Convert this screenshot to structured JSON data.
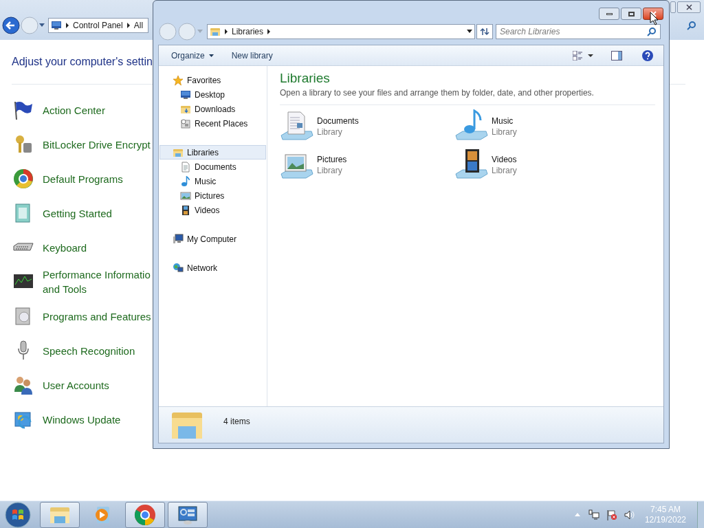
{
  "control_panel": {
    "breadcrumb": [
      "Control Panel",
      "All"
    ],
    "heading": "Adjust your computer's settin",
    "items": [
      {
        "label": "Action Center",
        "kind": "flag"
      },
      {
        "label": "BitLocker Drive Encrypt",
        "kind": "keys"
      },
      {
        "label": "Default Programs",
        "kind": "orb"
      },
      {
        "label": "Getting Started",
        "kind": "doc"
      },
      {
        "label": "Keyboard",
        "kind": "keyboard"
      },
      {
        "label": "Performance Informatio and Tools",
        "kind": "monitor"
      },
      {
        "label": "Programs and Features",
        "kind": "box"
      },
      {
        "label": "Speech Recognition",
        "kind": "mic"
      },
      {
        "label": "User Accounts",
        "kind": "users"
      },
      {
        "label": "Windows Update",
        "kind": "update"
      }
    ]
  },
  "explorer": {
    "breadcrumb": [
      "Libraries"
    ],
    "search": {
      "placeholder": "Search Libraries"
    },
    "toolbar": [
      {
        "label": "Organize",
        "dropdown": true
      },
      {
        "label": "New library",
        "dropdown": false
      }
    ],
    "nav": [
      {
        "label": "Favorites",
        "kind": "star",
        "selected": false,
        "children": [
          {
            "label": "Desktop",
            "kind": "desktop",
            "selected": false
          },
          {
            "label": "Downloads",
            "kind": "folder",
            "selected": false
          },
          {
            "label": "Recent Places",
            "kind": "recent",
            "selected": false
          }
        ]
      },
      {
        "label": "Libraries",
        "kind": "library",
        "selected": true,
        "children": [
          {
            "label": "Documents",
            "kind": "doc",
            "selected": false
          },
          {
            "label": "Music",
            "kind": "note",
            "selected": false
          },
          {
            "label": "Pictures",
            "kind": "picture",
            "selected": false
          },
          {
            "label": "Videos",
            "kind": "film",
            "selected": false
          }
        ]
      },
      {
        "label": "My Computer",
        "kind": "computer",
        "selected": false
      },
      {
        "label": "Network",
        "kind": "network",
        "selected": false
      }
    ],
    "title": "Libraries",
    "subtitle": "Open a library to see your files and arrange them by folder, date, and other properties.",
    "libraries": [
      {
        "name": "Documents",
        "type": "Library",
        "kind": "doc"
      },
      {
        "name": "Music",
        "type": "Library",
        "kind": "note"
      },
      {
        "name": "Pictures",
        "type": "Library",
        "kind": "picture"
      },
      {
        "name": "Videos",
        "type": "Library",
        "kind": "film"
      }
    ],
    "status": "4 items"
  },
  "taskbar": {
    "apps": [
      {
        "kind": "explorer",
        "open": true
      },
      {
        "kind": "media",
        "open": false
      },
      {
        "kind": "chrome",
        "open": true
      },
      {
        "kind": "control",
        "open": true
      }
    ],
    "time": "7:45 AM",
    "date": "12/19/2022"
  }
}
